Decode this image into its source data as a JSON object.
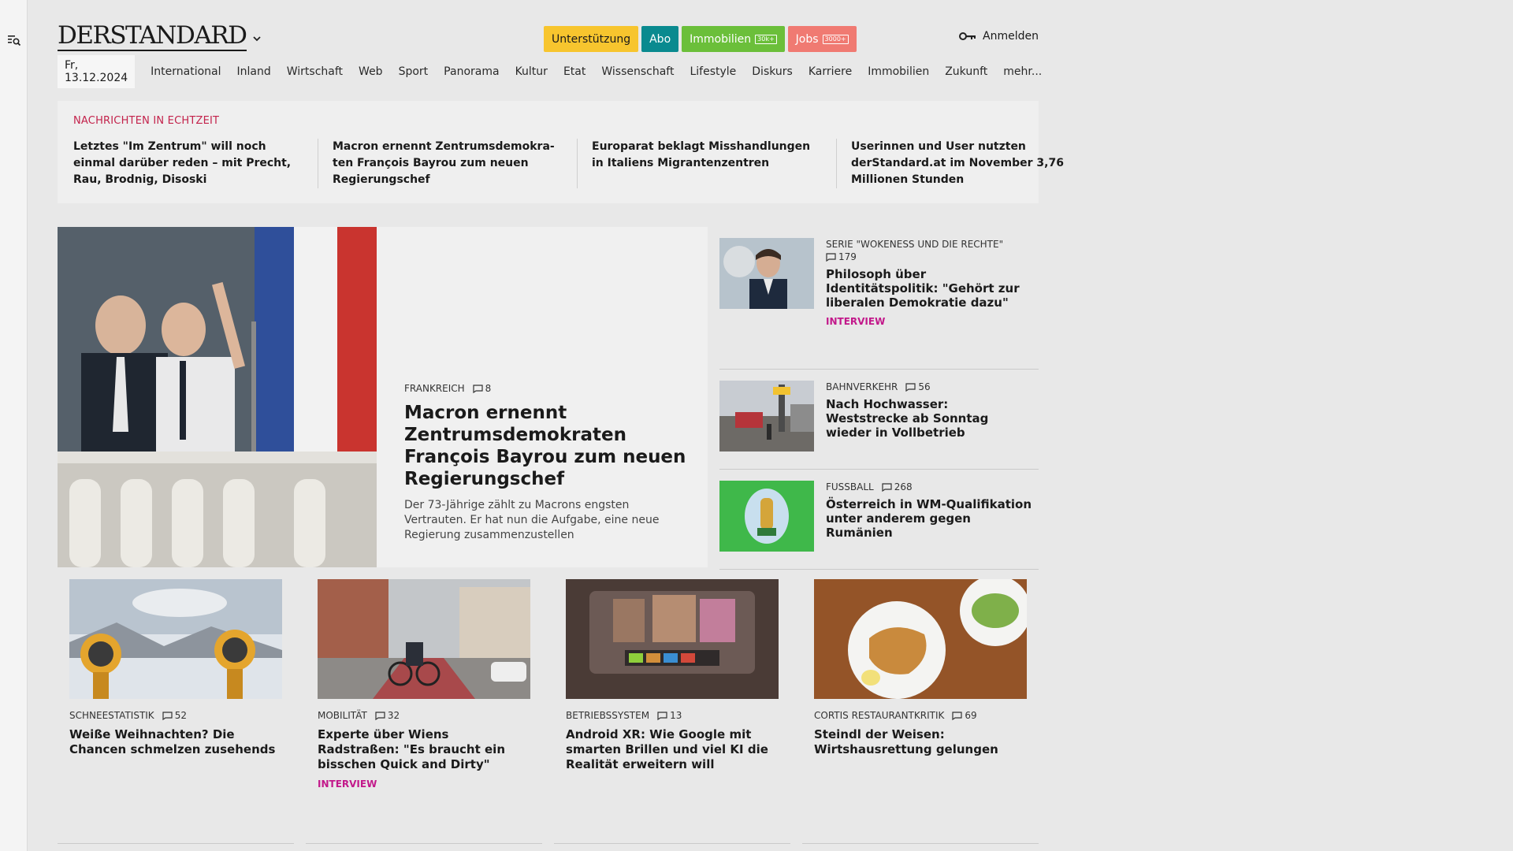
{
  "site": {
    "logo": "DERSTANDARD"
  },
  "header": {
    "pills": [
      {
        "label": "Unterstützung",
        "bg": "#f7c52e",
        "fg": "#1a1a1a",
        "badge": ""
      },
      {
        "label": "Abo",
        "bg": "#0a8a8f",
        "fg": "#ffffff",
        "badge": ""
      },
      {
        "label": "Immobilien",
        "bg": "#6bbf3a",
        "fg": "#ffffff",
        "badge": "30k+"
      },
      {
        "label": "Jobs",
        "bg": "#f07a72",
        "fg": "#ffffff",
        "badge": "3000+"
      }
    ],
    "login_label": "Anmelden"
  },
  "nav": {
    "date": "Fr, 13.12.2024",
    "items": [
      "International",
      "Inland",
      "Wirtschaft",
      "Web",
      "Sport",
      "Panorama",
      "Kultur",
      "Etat",
      "Wissenschaft",
      "Lifestyle",
      "Diskurs",
      "Karriere",
      "Immobilien",
      "Zukunft",
      "mehr..."
    ]
  },
  "ticker": {
    "title": "Nachrichten in Echtzeit",
    "items": [
      "Letztes \"Im Zentrum\" will noch einmal darüber reden – mit Precht, Rau, Brodnig, Disoski",
      "Macron ernennt Zentrumsdemokra­ten François Bayrou zum neuen Regierungschef",
      "Europarat beklagt Misshandlungen in Italiens Migrantenzentren",
      "Userinnen und User nutzten derStandard.at im November 3,76 Millionen Stunden"
    ]
  },
  "hero": {
    "kicker": "Frankreich",
    "comments": "8",
    "headline": "Macron ernennt Zentrumsde­mokraten François Bayrou zum neuen Regierungschef",
    "teaser": "Der 73-Jährige zählt zu Macrons engsten Vertrauten. Er hat nun die Aufgabe, eine neue Regierung zusammenzustellen"
  },
  "side": [
    {
      "kicker": "Serie \"Wokeness und die Rechte\"",
      "comments": "179",
      "headline": "Philosoph über Identitätspolitik: \"Gehört zur liberalen Demokratie dazu\"",
      "label": "Interview"
    },
    {
      "kicker": "Bahnverkehr",
      "comments": "56",
      "headline": "Nach Hochwasser: Weststrecke ab Sonntag wieder in Vollbetrieb",
      "label": ""
    },
    {
      "kicker": "Fussball",
      "comments": "268",
      "headline": "Österreich in WM-Qualifikation unter anderem gegen Rumänien",
      "label": ""
    }
  ],
  "cards": [
    {
      "kicker": "Schneestatistik",
      "comments": "52",
      "headline": "Weiße Weihnachten? Die Chancen schmelzen zusehends",
      "label": ""
    },
    {
      "kicker": "Mobilität",
      "comments": "32",
      "headline": "Experte über Wiens Radstraßen: \"Es braucht ein bisschen Quick and Dirty\"",
      "label": "Interview"
    },
    {
      "kicker": "Betriebssystem",
      "comments": "13",
      "headline": "Android XR: Wie Google mit smarten Brillen und viel KI die Realität erweitern will",
      "label": ""
    },
    {
      "kicker": "Cortis Restaurantkritik",
      "comments": "69",
      "headline": "Steindl der Weisen: Wirtshausret­tung gelungen",
      "label": ""
    }
  ]
}
